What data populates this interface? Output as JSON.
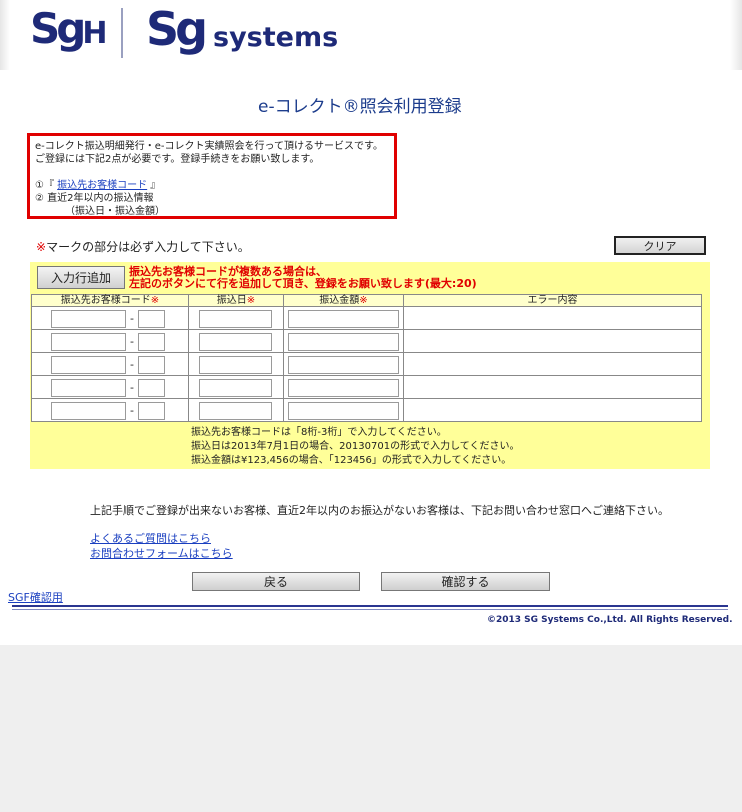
{
  "header": {
    "logo_sgh_s": "S",
    "logo_sgh_g": "g",
    "logo_sgh_h": "H",
    "logo_sg": "Sg",
    "logo_systems": "systems"
  },
  "page_title": "e-コレクト®照会利用登録",
  "notice": {
    "line1": "e-コレクト振込明細発行・e-コレクト実績照会を行って頂けるサービスです。",
    "line2": "ご登録には下記2点が必要です。登録手続きをお願い致します。",
    "item1_prefix": "①『 ",
    "item1_link": "振込先お客様コード",
    "item1_suffix": " 』",
    "item2": "② 直近2年以内の振込情報",
    "item2_detail": "（振込日・振込金額）"
  },
  "required_note_mark": "※",
  "required_note": "マークの部分は必ず入力して下さい。",
  "clear_button": "クリア",
  "add_row_button": "入力行追加",
  "add_note_line1": "振込先お客様コードが複数ある場合は、",
  "add_note_line2": "左記のボタンにて行を追加して頂き、登録をお願い致します(最大:20)",
  "table": {
    "headers": [
      "振込先お客様コード",
      "振込日",
      "振込金額",
      "エラー内容"
    ],
    "required_mark": "※",
    "rows": [
      {
        "code1": "",
        "code2": "",
        "date": "",
        "amount": "",
        "error": ""
      },
      {
        "code1": "",
        "code2": "",
        "date": "",
        "amount": "",
        "error": ""
      },
      {
        "code1": "",
        "code2": "",
        "date": "",
        "amount": "",
        "error": ""
      },
      {
        "code1": "",
        "code2": "",
        "date": "",
        "amount": "",
        "error": ""
      },
      {
        "code1": "",
        "code2": "",
        "date": "",
        "amount": "",
        "error": ""
      }
    ],
    "dash": "-"
  },
  "hints": [
    "振込先お客様コードは「8桁-3桁」で入力してください。",
    "振込日は2013年7月1日の場合、20130701の形式で入力してください。",
    "振込金額は¥123,456の場合、「123456」の形式で入力してください。"
  ],
  "footer_text": "上記手順でご登録が出来ないお客様、直近2年以内のお振込がないお客様は、下記お問い合わせ窓口へご連絡下さい。",
  "faq_link": "よくあるご質問はこちら",
  "contact_link": "お問合わせフォームはこちら",
  "back_button": "戻る",
  "confirm_button": "確認する",
  "sgf_link": "SGF確認用",
  "copyright": "©2013  SG Systems   Co.,Ltd. All Rights Reserved.",
  "colors": {
    "accent": "#1e2a78",
    "required": "#e00000",
    "form_bg": "#ffff99",
    "link": "#1a3fc0"
  }
}
